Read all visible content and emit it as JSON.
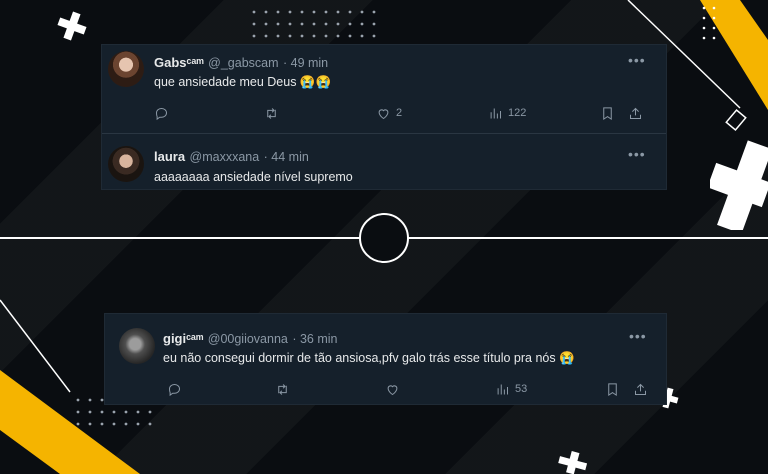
{
  "tweets": [
    {
      "name": "Gabsᶜᵃᵐ",
      "handle": "@_gabscam",
      "time": "· 49 min",
      "text": "que ansiedade meu Deus 😭😭",
      "likes": "2",
      "views": "122"
    },
    {
      "name": "laura",
      "handle": "@maxxxana",
      "time": "· 44 min",
      "text": "aaaaaaaa ansiedade nível supremo"
    },
    {
      "name": "gigiᶜᵃᵐ",
      "handle": "@00giiovanna",
      "time": "· 36 min",
      "text": "eu não consegui dormir de tão ansiosa,pfv galo trás esse título pra nós 😭",
      "views": "53"
    }
  ],
  "icons": {
    "more": "more-icon",
    "reply": "reply-icon",
    "retweet": "retweet-icon",
    "like": "heart-icon",
    "views": "views-icon",
    "bookmark": "bookmark-icon",
    "share": "share-icon"
  },
  "colors": {
    "accent_yellow": "#f5b400",
    "card_bg": "#15202b",
    "muted_text": "#8b98a5"
  }
}
